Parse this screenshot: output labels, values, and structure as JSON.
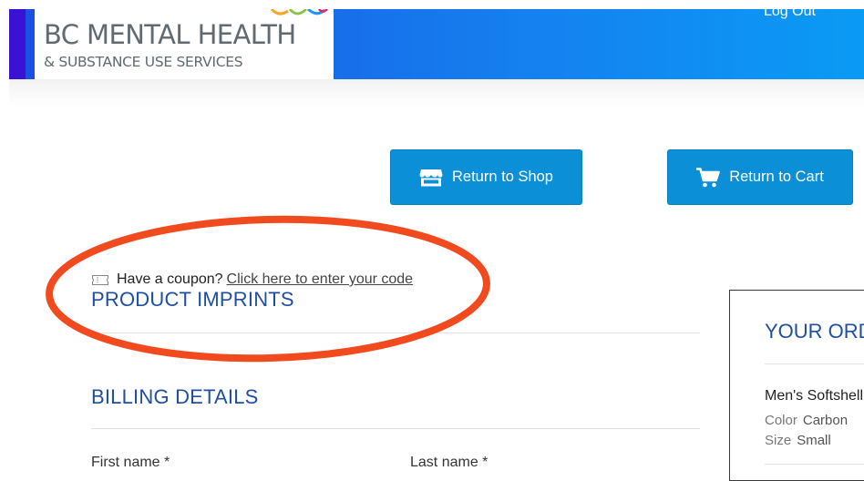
{
  "header": {
    "logo_title": "BC MENTAL HEALTH",
    "logo_subtitle": "& SUBSTANCE USE SERVICES",
    "logout_label": "Log Out"
  },
  "actions": {
    "return_to_shop_label": "Return to Shop",
    "return_to_cart_label": "Return to Cart"
  },
  "coupon": {
    "prompt": "Have a coupon?",
    "link_text": "Click here to enter your code"
  },
  "sections": {
    "imprints_title": "PRODUCT IMPRINTS",
    "billing_title": "BILLING DETAILS"
  },
  "billing_fields": {
    "first_name_label": "First name *",
    "last_name_label": "Last name *"
  },
  "order": {
    "title": "YOUR ORDER",
    "item_name": "Men's Softshell",
    "color_label": "Color",
    "color_value": "Carbon",
    "size_label": "Size",
    "size_value": "Small"
  },
  "colors": {
    "header_gradient_start": "#1b4fe0",
    "header_gradient_end": "#0a9bf5",
    "button_blue": "#0b8fd6",
    "heading_blue": "#1f4fa3",
    "annotation_red": "#f24a1f"
  },
  "icons": {
    "shop": "storefront-icon",
    "cart": "shopping-cart-icon",
    "coupon": "ticket-icon"
  }
}
